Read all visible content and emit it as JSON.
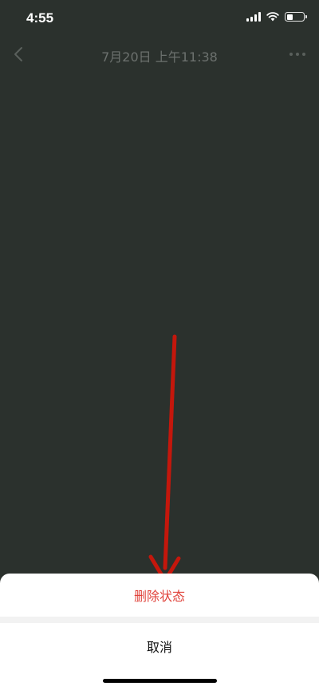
{
  "status_bar": {
    "time": "4:55",
    "icons": [
      "signal-icon",
      "wifi-icon",
      "battery-icon"
    ],
    "battery_level_percent": 35
  },
  "nav_bar": {
    "title": "7月20日 上午11:38",
    "left_icon": "chevron-left-icon",
    "right_icon": "more-dots-icon"
  },
  "action_sheet": {
    "delete_label": "删除状态",
    "cancel_label": "取消"
  },
  "colors": {
    "background": "#2b312d",
    "danger": "#e0423a",
    "annotation_arrow": "#c4170c"
  }
}
